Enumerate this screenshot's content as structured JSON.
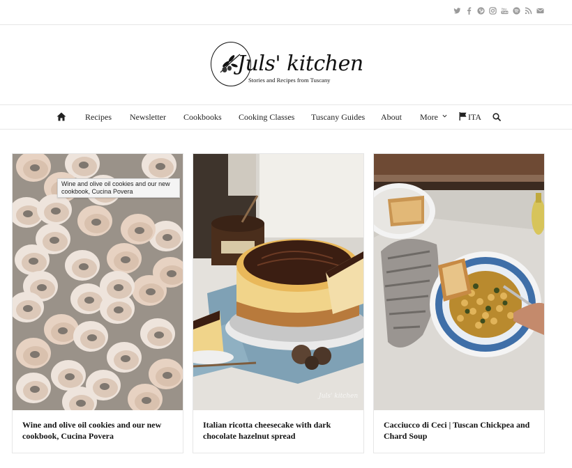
{
  "social": {
    "icons": [
      "twitter-icon",
      "facebook-icon",
      "pinterest-icon",
      "instagram-icon",
      "youtube-icon",
      "spotify-icon",
      "rss-icon",
      "email-icon"
    ]
  },
  "logo": {
    "name": "Juls' kitchen",
    "tagline": "Stories and Recipes from Tuscany"
  },
  "nav": {
    "items": [
      "Recipes",
      "Newsletter",
      "Cookbooks",
      "Cooking Classes",
      "Tuscany Guides",
      "About",
      "More",
      "ITA"
    ]
  },
  "tooltip": {
    "text": "Wine and olive oil cookies and our new cookbook, Cucina Povera"
  },
  "cards": [
    {
      "title": "Wine and olive oil cookies and our new cookbook, Cucina Povera"
    },
    {
      "title": "Italian ricotta cheesecake with dark chocolate hazelnut spread"
    },
    {
      "title": "Cacciucco di Ceci | Tuscan Chickpea and Chard Soup"
    }
  ],
  "colors": {
    "icon_gray": "#9a9a9a",
    "border": "#e6e6e6",
    "text": "#222222"
  }
}
